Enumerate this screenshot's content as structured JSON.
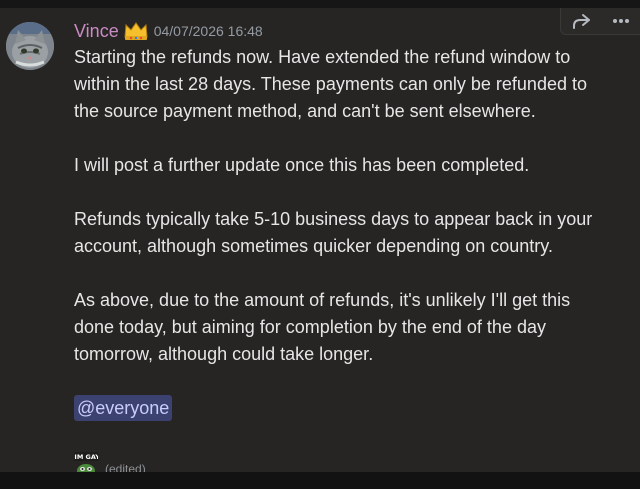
{
  "message": {
    "author": "Vince",
    "timestamp": "04/07/2026 16:48",
    "paragraphs": [
      {
        "lines": [
          "Starting the refunds now. Have extended the refund window to",
          "within the last 28 days. These payments can only be refunded to",
          "the source payment method, and can't be sent elsewhere."
        ]
      },
      {
        "lines": [
          "I will post a further update once this has been completed."
        ]
      },
      {
        "lines": [
          "Refunds typically take 5-10 business days to appear back in your",
          "account, although sometimes quicker depending on country."
        ]
      },
      {
        "lines": [
          "As above, due to the amount of refunds, it's unlikely I'll get this",
          "done today, but aiming for completion by the end of the day",
          "tomorrow, although could take longer."
        ]
      }
    ],
    "mention": "@everyone",
    "emote_text": "JIM GAY",
    "edited_label": "(edited)"
  },
  "toolbar": {
    "icons": [
      "share-icon",
      "more-icon"
    ]
  },
  "colors": {
    "username": "#c98bc4",
    "mention_bg": "#3c4270",
    "mention_text": "#c9cdfb",
    "text": "#e6e6e6",
    "muted": "#949ba4"
  }
}
